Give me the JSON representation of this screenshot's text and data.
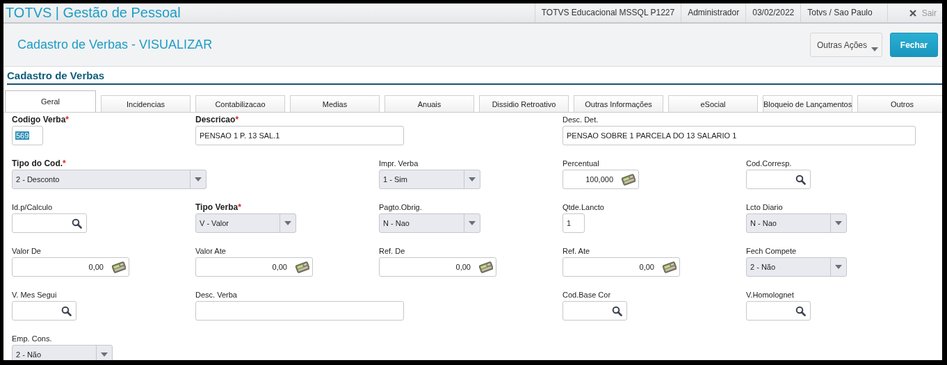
{
  "header": {
    "title": "TOTVS | Gestão de Pessoal",
    "info": [
      "TOTVS Educacional MSSQL P1227",
      "Administrador",
      "03/02/2022",
      "Totvs / Sao Paulo"
    ],
    "logout": "Sair"
  },
  "page": {
    "title": "Cadastro de Verbas - VISUALIZAR",
    "actions": [
      {
        "label": "Outras Ações",
        "kind": "menu"
      },
      {
        "label": "Fechar",
        "kind": "primary"
      }
    ]
  },
  "section": {
    "title": "Cadastro de Verbas"
  },
  "tabs": [
    {
      "label": "Geral",
      "selected": true
    },
    {
      "label": "Incidencias",
      "selected": false
    },
    {
      "label": "Contabilizacao",
      "selected": false
    },
    {
      "label": "Medias",
      "selected": false
    },
    {
      "label": "Anuais",
      "selected": false
    },
    {
      "label": "Dissidio Retroativo",
      "selected": false
    },
    {
      "label": "Outras Informações",
      "selected": false
    },
    {
      "label": "eSocial",
      "selected": false
    },
    {
      "label": "Bloqueio de Lançamentos",
      "selected": false
    },
    {
      "label": "Outros",
      "selected": false
    }
  ],
  "rows": [
    [
      {
        "label": "Codigo Verba",
        "required": true,
        "required_mark": "*",
        "kind": "text",
        "value": "569",
        "highlighted": true
      },
      {
        "label": "Descricao",
        "required": true,
        "required_mark": "*",
        "kind": "text",
        "value": "PENSAO 1 P. 13 SAL.1",
        "highlighted": false
      },
      {
        "label": "Desc. Det.",
        "required": false,
        "kind": "text",
        "value": "PENSAO SOBRE 1 PARCELA DO 13 SALARIO 1",
        "highlighted": false
      }
    ],
    [
      {
        "label": "Tipo do Cod.",
        "required": true,
        "required_mark": "*",
        "kind": "select",
        "value": "2 - Desconto",
        "highlighted": false
      },
      {
        "label": "Impr. Verba",
        "required": false,
        "kind": "select",
        "value": "1 - Sim",
        "highlighted": false
      },
      {
        "label": "Percentual",
        "required": false,
        "kind": "number",
        "value": "100,000",
        "highlighted": false
      },
      {
        "label": "Cod.Corresp.",
        "required": false,
        "kind": "lookup"
      }
    ],
    [
      {
        "label": "Id.p/Calculo",
        "required": false,
        "kind": "lookup"
      },
      {
        "label": "Tipo Verba",
        "required": true,
        "required_mark": "*",
        "kind": "select",
        "value": "V - Valor",
        "highlighted": false
      },
      {
        "label": "Pagto.Obrig.",
        "required": false,
        "kind": "select",
        "value": "N - Nao",
        "highlighted": false
      },
      {
        "label": "Qtde.Lancto",
        "required": false,
        "kind": "text",
        "value": "1",
        "highlighted": false
      },
      {
        "label": "Lcto Diario",
        "required": false,
        "kind": "select",
        "value": "N - Nao",
        "highlighted": false
      }
    ],
    [
      {
        "label": "Valor De",
        "required": false,
        "kind": "number",
        "value": "0,00",
        "highlighted": false
      },
      {
        "label": "Valor Ate",
        "required": false,
        "kind": "number",
        "value": "0,00",
        "highlighted": false
      },
      {
        "label": "Ref. De",
        "required": false,
        "kind": "number",
        "value": "0,00",
        "highlighted": false
      },
      {
        "label": "Ref. Ate",
        "required": false,
        "kind": "number",
        "value": "0,00",
        "highlighted": false
      },
      {
        "label": "Fech Compete",
        "required": false,
        "kind": "select",
        "value": "2 - Não",
        "highlighted": false
      }
    ],
    [
      {
        "label": "V. Mes Segui",
        "required": false,
        "kind": "lookup"
      },
      {
        "label": "Desc. Verba",
        "required": false,
        "kind": "text"
      },
      {
        "label": "Cod.Base Cor",
        "required": false,
        "kind": "lookup"
      },
      {
        "label": "V.Homolognet",
        "required": false,
        "kind": "lookup"
      }
    ],
    [
      {
        "label": "Emp. Cons.",
        "required": false,
        "kind": "select",
        "value": "2 - Não",
        "highlighted": false
      }
    ]
  ]
}
